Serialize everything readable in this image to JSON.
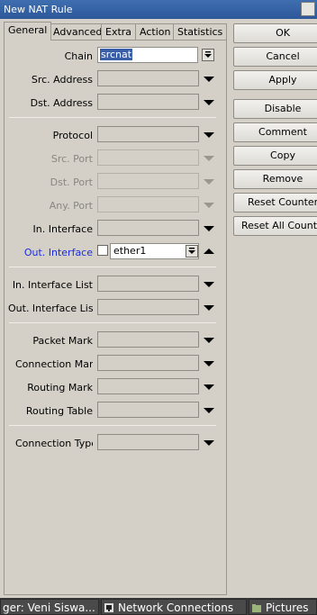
{
  "window": {
    "title": "New NAT Rule"
  },
  "tabs": [
    "General",
    "Advanced",
    "Extra",
    "Action",
    "Statistics"
  ],
  "fields": {
    "chain": {
      "label": "Chain",
      "value": "srcnat"
    },
    "src_address": {
      "label": "Src. Address"
    },
    "dst_address": {
      "label": "Dst. Address"
    },
    "protocol": {
      "label": "Protocol"
    },
    "src_port": {
      "label": "Src. Port"
    },
    "dst_port": {
      "label": "Dst. Port"
    },
    "any_port": {
      "label": "Any. Port"
    },
    "in_interface": {
      "label": "In. Interface"
    },
    "out_interface": {
      "label": "Out. Interface",
      "value": "ether1"
    },
    "in_interface_list": {
      "label": "In. Interface List"
    },
    "out_interface_list": {
      "label": "Out. Interface List"
    },
    "packet_mark": {
      "label": "Packet Mark"
    },
    "connection_mark": {
      "label": "Connection Mark"
    },
    "routing_mark": {
      "label": "Routing Mark"
    },
    "routing_table": {
      "label": "Routing Table"
    },
    "connection_type": {
      "label": "Connection Type"
    }
  },
  "buttons": {
    "ok": "OK",
    "cancel": "Cancel",
    "apply": "Apply",
    "disable": "Disable",
    "comment": "Comment",
    "copy": "Copy",
    "remove": "Remove",
    "reset_counters": "Reset Counters",
    "reset_all_counters": "Reset All Counters"
  },
  "taskbar": {
    "item1": "ger: Veni Siswa...",
    "item2": "Network Connections",
    "item3": "Pictures"
  },
  "colors": {
    "title_bar": "#2d5799",
    "selection": "#3a5fa8",
    "active_label": "#1a2de0"
  }
}
